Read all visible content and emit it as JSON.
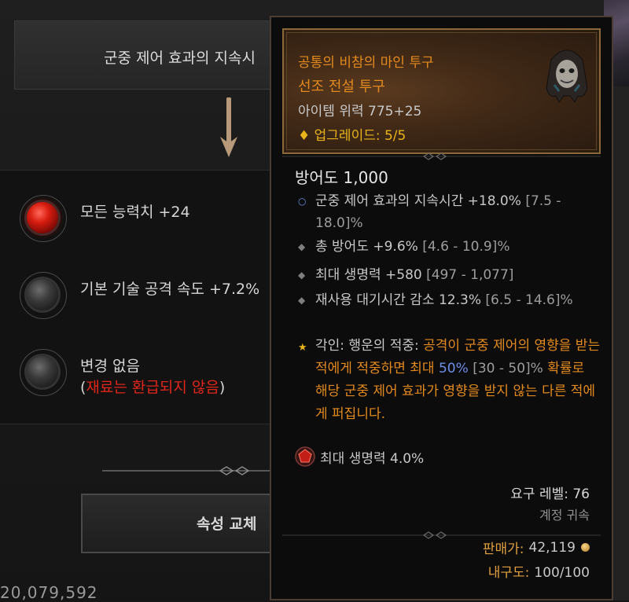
{
  "background": {
    "option_banner": "군중 제어 효과의 지속시",
    "options": [
      {
        "label": "모든 능력치 +24",
        "gem": "red"
      },
      {
        "label": "기본 기술 공격 속도 +7.2%",
        "gem": "dark"
      },
      {
        "label": "변경 없음",
        "sub_open": "(",
        "sub_red": "재료는 환급되지 않음",
        "sub_close": ")",
        "gem": "dark"
      }
    ],
    "swap_button": "속성 교체",
    "gold_amount": "20,079,592"
  },
  "tooltip": {
    "item_name": "공통의 비참의 마인 투구",
    "item_type": "선조 전설 투구",
    "item_power": "아이템 위력 775+25",
    "upgrade": "업그레이드: 5/5",
    "armor": "방어도 1,000",
    "stats": [
      {
        "bullet": "○",
        "text": "군중 제어 효과의 지속시간 +18.0%",
        "range": "[7.5 - 18.0]%"
      },
      {
        "bullet": "◆",
        "text": "총 방어도 +9.6%",
        "range": "[4.6 - 10.9]%"
      },
      {
        "bullet": "◆",
        "text": "최대 생명력 +580",
        "range": "[497 - 1,077]"
      },
      {
        "bullet": "◆",
        "text": "재사용 대기시간 감소 12.3%",
        "range": "[6.5 - 14.6]%"
      }
    ],
    "aspect": {
      "name": "각인: 행운의 적중:",
      "text_1": "공격이 군중 제어의 영향을 받는 적에게 적중하면 최대",
      "value": "50%",
      "range": "[30 - 50]%",
      "text_2": "확률로 해당 군중 제어 효과가 영향을 받지 않는 다른 적에게 퍼집니다."
    },
    "gem_stat": "최대 생명력 4.0%",
    "required_level": "요구 레벨: 76",
    "account_bound": "계정 귀속",
    "sell_label": "판매가:",
    "sell_value": "42,119",
    "durability_label": "내구도:",
    "durability_value": "100/100"
  },
  "colors": {
    "legendary": "#e38a1e",
    "upgrade": "#e8b41a",
    "highlight_blue": "#6c8fe8",
    "warning_red": "#e0261a"
  }
}
